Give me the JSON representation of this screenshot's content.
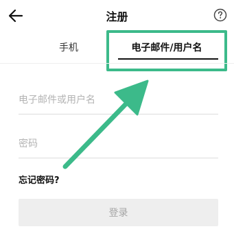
{
  "header": {
    "title": "注册",
    "back_icon": "arrow-left-icon",
    "help_icon": "question-circle-icon"
  },
  "tabs": [
    {
      "label": "手机",
      "active": false
    },
    {
      "label": "电子邮件/用户名",
      "active": true
    }
  ],
  "form": {
    "username_placeholder": "电子邮件或用户名",
    "password_placeholder": "密码",
    "forgot_label": "忘记密码?",
    "login_label": "登录"
  },
  "colors": {
    "highlight": "#3cba8a",
    "login_button_bg": "#eeeeee",
    "login_button_text": "#a5a5a5"
  }
}
